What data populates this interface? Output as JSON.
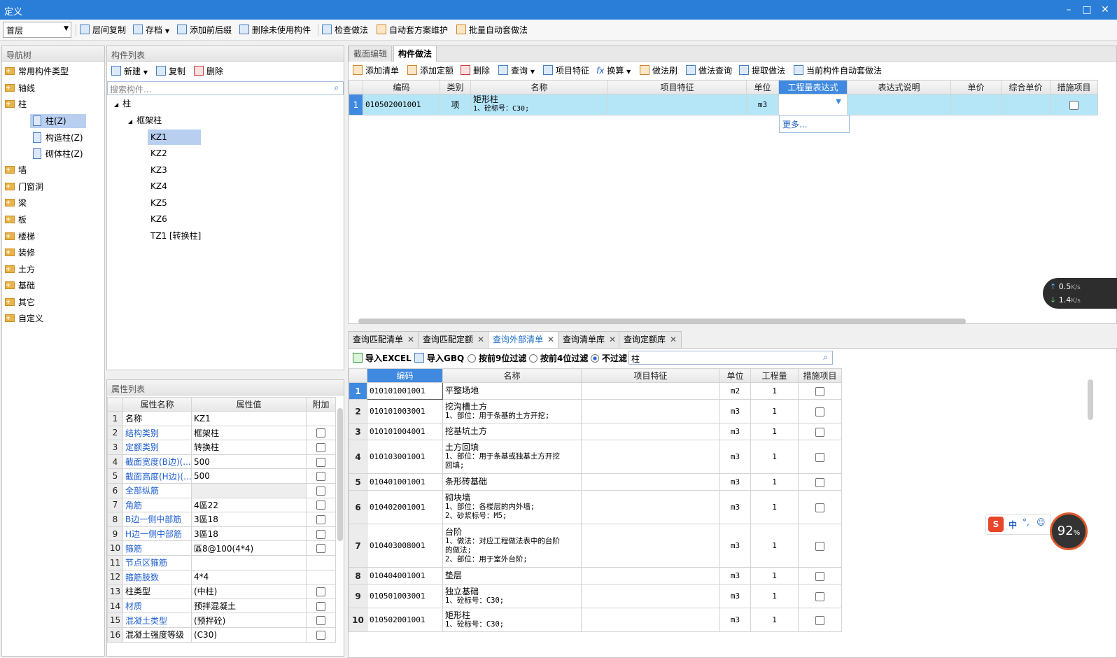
{
  "window": {
    "title": "定义"
  },
  "toolbar": {
    "floor": "首层",
    "items": [
      "层间复制",
      "存档",
      "添加前后缀",
      "删除未使用构件",
      "检查做法",
      "自动套方案维护",
      "批量自动套做法"
    ]
  },
  "nav": {
    "title": "导航树",
    "items": [
      "常用构件类型",
      "轴线",
      "柱",
      "墙",
      "门窗洞",
      "梁",
      "板",
      "楼梯",
      "装修",
      "土方",
      "基础",
      "其它",
      "自定义"
    ],
    "sub": [
      "柱(Z)",
      "构造柱(Z)",
      "砌体柱(Z)"
    ]
  },
  "comp": {
    "title": "构件列表",
    "new": "新建",
    "copy": "复制",
    "delete": "删除",
    "search_placeholder": "搜索构件...",
    "root": "柱",
    "group": "框架柱",
    "items": [
      "KZ1",
      "KZ2",
      "KZ3",
      "KZ4",
      "KZ5",
      "KZ6",
      "TZ1 [转换柱]"
    ]
  },
  "props": {
    "title": "属性列表",
    "headers": [
      "属性名称",
      "属性值",
      "附加"
    ],
    "rows": [
      {
        "n": "1",
        "name": "名称",
        "value": "KZ1"
      },
      {
        "n": "2",
        "name": "结构类别",
        "value": "框架柱"
      },
      {
        "n": "3",
        "name": "定额类别",
        "value": "转换柱"
      },
      {
        "n": "4",
        "name": "截面宽度(B边)(...",
        "value": "500"
      },
      {
        "n": "5",
        "name": "截面高度(H边)(...",
        "value": "500"
      },
      {
        "n": "6",
        "name": "全部纵筋",
        "value": ""
      },
      {
        "n": "7",
        "name": "角筋",
        "value": "4區22"
      },
      {
        "n": "8",
        "name": "B边一侧中部筋",
        "value": "3區18"
      },
      {
        "n": "9",
        "name": "H边一侧中部筋",
        "value": "3區18"
      },
      {
        "n": "10",
        "name": "箍筋",
        "value": "區8@100(4*4)"
      },
      {
        "n": "11",
        "name": "节点区箍筋",
        "value": ""
      },
      {
        "n": "12",
        "name": "箍筋肢数",
        "value": "4*4"
      },
      {
        "n": "13",
        "name": "柱类型",
        "value": "(中柱)"
      },
      {
        "n": "14",
        "name": "材质",
        "value": "预拌混凝土"
      },
      {
        "n": "15",
        "name": "混凝土类型",
        "value": "(预拌砼)"
      },
      {
        "n": "16",
        "name": "混凝土强度等级",
        "value": "(C30)"
      }
    ]
  },
  "method": {
    "tabs": [
      "截面编辑",
      "构件做法"
    ],
    "toolbar": [
      "添加清单",
      "添加定额",
      "删除",
      "查询",
      "项目特征",
      "换算",
      "做法刷",
      "做法查询",
      "提取做法",
      "当前构件自动套做法"
    ],
    "headers": [
      "编码",
      "类别",
      "名称",
      "项目特征",
      "单位",
      "工程量表达式",
      "表达式说明",
      "单价",
      "综合单价",
      "措施项目"
    ],
    "row": {
      "n": "1",
      "code": "010502001001",
      "type": "项",
      "name1": "矩形柱",
      "name2": "1、砼标号：C30;",
      "unit": "m3"
    },
    "dropdown_more": "更多..."
  },
  "query": {
    "tabs": [
      "查询匹配清单",
      "查询匹配定额",
      "查询外部清单",
      "查询清单库",
      "查询定额库"
    ],
    "import_excel": "导入EXCEL",
    "import_gbq": "导入GBQ",
    "filter9": "按前9位过滤",
    "filter4": "按前4位过滤",
    "nofilter": "不过滤",
    "search_value": "柱",
    "headers": [
      "编码",
      "名称",
      "项目特征",
      "单位",
      "工程量",
      "措施项目"
    ],
    "rows": [
      {
        "n": "1",
        "code": "010101001001",
        "name": [
          "平整场地"
        ],
        "unit": "m2",
        "qty": "1"
      },
      {
        "n": "2",
        "code": "010101003001",
        "name": [
          "挖沟槽土方",
          "1、部位：用于条基的土方开挖;"
        ],
        "unit": "m3",
        "qty": "1"
      },
      {
        "n": "3",
        "code": "010101004001",
        "name": [
          "挖基坑土方"
        ],
        "unit": "m3",
        "qty": "1"
      },
      {
        "n": "4",
        "code": "010103001001",
        "name": [
          "土方回填",
          "1、部位：用于条基或独基土方开挖",
          "回填;"
        ],
        "unit": "m3",
        "qty": "1"
      },
      {
        "n": "5",
        "code": "010401001001",
        "name": [
          "条形砖基础"
        ],
        "unit": "m3",
        "qty": "1"
      },
      {
        "n": "6",
        "code": "010402001001",
        "name": [
          "砌块墙",
          "1、部位：各楼层的内外墙;",
          "2、砂浆标号：M5;"
        ],
        "unit": "m3",
        "qty": "1"
      },
      {
        "n": "7",
        "code": "010403008001",
        "name": [
          "台阶",
          "1、做法：对应工程做法表中的台阶",
          "的做法;",
          "2、部位：用于室外台阶;"
        ],
        "unit": "m3",
        "qty": "1"
      },
      {
        "n": "8",
        "code": "010404001001",
        "name": [
          "垫层"
        ],
        "unit": "m3",
        "qty": "1"
      },
      {
        "n": "9",
        "code": "010501003001",
        "name": [
          "独立基础",
          "1、砼标号：C30;"
        ],
        "unit": "m3",
        "qty": "1"
      },
      {
        "n": "10",
        "code": "010502001001",
        "name": [
          "矩形柱",
          "1、砼标号：C30;"
        ],
        "unit": "m3",
        "qty": "1"
      }
    ]
  },
  "overlay": {
    "up": "0.5",
    "down": "1.4",
    "speed_unit": "K/s",
    "ime_label": "中",
    "cpu": "92"
  }
}
